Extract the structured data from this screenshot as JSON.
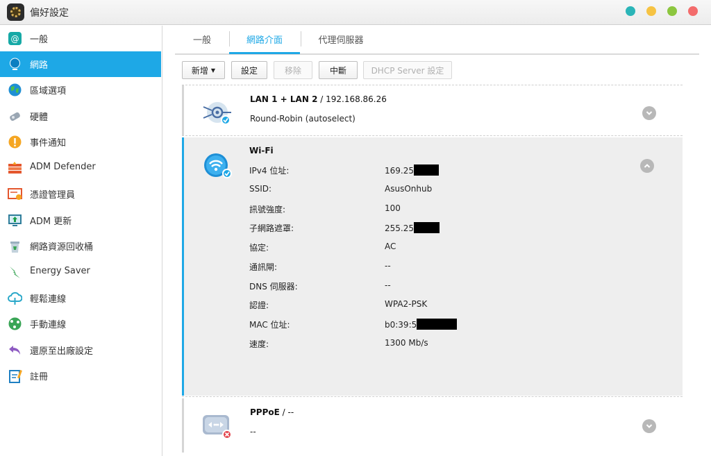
{
  "window": {
    "title": "偏好設定"
  },
  "sidebar": {
    "items": [
      {
        "label": "一般"
      },
      {
        "label": "網路"
      },
      {
        "label": "區域選項"
      },
      {
        "label": "硬體"
      },
      {
        "label": "事件通知"
      },
      {
        "label": "ADM Defender"
      },
      {
        "label": "憑證管理員"
      },
      {
        "label": "ADM 更新"
      },
      {
        "label": "網路資源回收桶"
      },
      {
        "label": "Energy Saver"
      },
      {
        "label": "輕鬆連線"
      },
      {
        "label": "手動連線"
      },
      {
        "label": "還原至出廠設定"
      },
      {
        "label": "註冊"
      }
    ]
  },
  "tabs": [
    {
      "label": "一般"
    },
    {
      "label": "網路介面"
    },
    {
      "label": "代理伺服器"
    }
  ],
  "toolbar": {
    "add": "新增",
    "settings": "設定",
    "remove": "移除",
    "disconnect": "中斷",
    "dhcp": "DHCP Server 設定"
  },
  "interfaces": {
    "lan": {
      "name": "LAN 1 + LAN 2",
      "ip": " / 192.168.86.26",
      "mode": "Round-Robin (autoselect)"
    },
    "wifi": {
      "name": "Wi-Fi",
      "rows": [
        {
          "label": "IPv4 位址:",
          "value": "169.25"
        },
        {
          "label": "SSID:",
          "value": "AsusOnhub"
        },
        {
          "label": "訊號強度:",
          "value": "100"
        },
        {
          "label": "子網路遮罩:",
          "value": "255.25"
        },
        {
          "label": "協定:",
          "value": "AC"
        },
        {
          "label": "通訊閘:",
          "value": "--"
        },
        {
          "label": "DNS 伺服器:",
          "value": "--"
        },
        {
          "label": "認證:",
          "value": "WPA2-PSK"
        },
        {
          "label": "MAC 位址:",
          "value": "b0:39:5"
        },
        {
          "label": "速度:",
          "value": "1300 Mb/s"
        }
      ]
    },
    "pppoe": {
      "name": "PPPoE",
      "suffix": " / --",
      "status": "--"
    }
  },
  "colors": {
    "accent": "#1ea8e6",
    "close": "#f36c6c",
    "maximize": "#8cc63f",
    "minimize": "#f6c343",
    "extra": "#2bb5b8"
  }
}
